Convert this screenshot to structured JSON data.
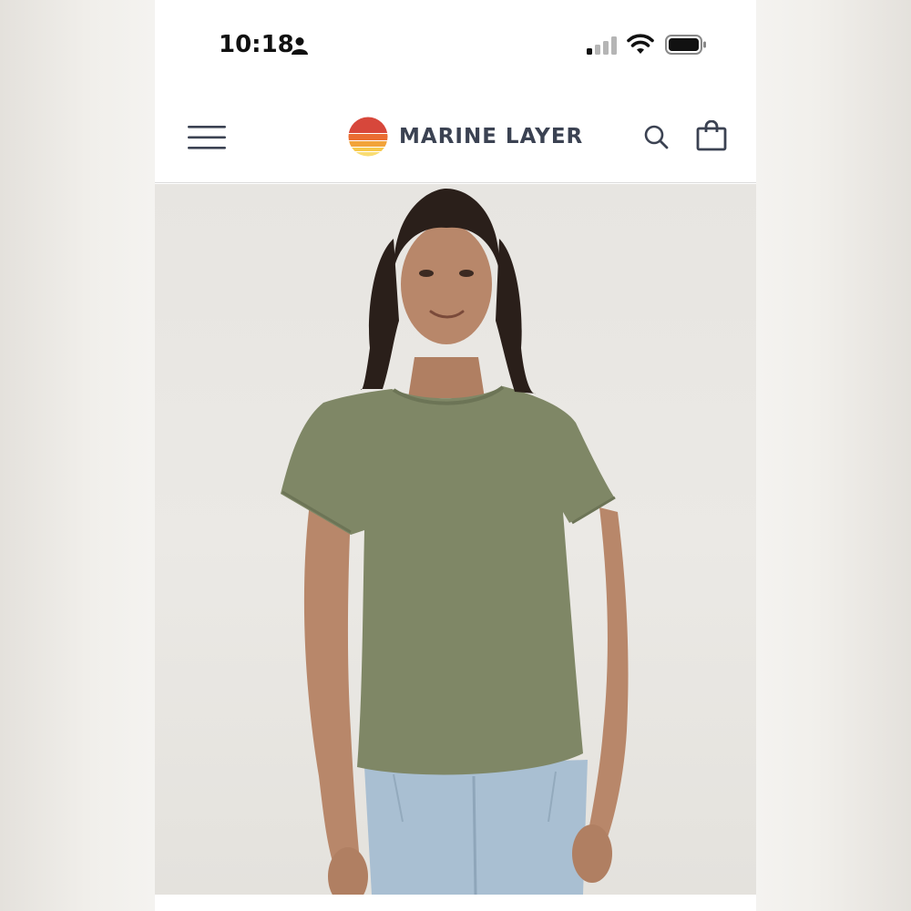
{
  "status_bar": {
    "time": "10:18",
    "icons": [
      "person-icon",
      "cellular-signal-icon",
      "wifi-icon",
      "battery-icon"
    ]
  },
  "header": {
    "brand_name": "MARINE LAYER",
    "icons": [
      "menu-icon",
      "search-icon",
      "shopping-bag-icon"
    ]
  },
  "product": {
    "image_colors": {
      "shirt": "#7f8766",
      "background": "#e7e5e1",
      "jeans": "#a9bfd2"
    }
  },
  "colors": {
    "brand_text": "#3b4252",
    "logo_stripes": [
      "#d7473b",
      "#ea6d32",
      "#f2a33a",
      "#f7c94c",
      "#f9dc72"
    ]
  }
}
